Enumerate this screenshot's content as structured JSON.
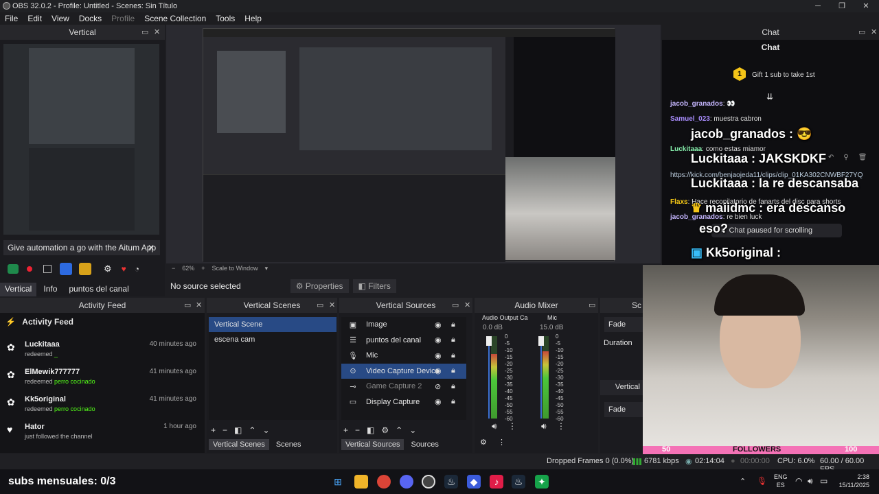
{
  "window": {
    "title": "OBS 32.0.2 - Profile: Untitled - Scenes: Sin Título"
  },
  "menu": [
    "File",
    "Edit",
    "View",
    "Docks",
    "Profile",
    "Scene Collection",
    "Tools",
    "Help"
  ],
  "vertical_dock": {
    "title": "Vertical",
    "banner": "Give automation a go with the Aitum App",
    "tabs": [
      "Vertical",
      "Info",
      "puntos del canal"
    ]
  },
  "canvas": {
    "zoom": "62%",
    "scale_mode": "Scale to Window",
    "no_source": "No source selected",
    "properties_label": "Properties",
    "filters_label": "Filters"
  },
  "activity_feed": {
    "dock_title": "Activity Feed",
    "header": "Activity Feed",
    "items": [
      {
        "name": "Luckitaaa",
        "action": "redeemed",
        "reward": "_",
        "time": "40 minutes ago"
      },
      {
        "name": "ElMewik777777",
        "action": "redeemed",
        "reward": "perro cocinado",
        "time": "41 minutes ago"
      },
      {
        "name": "Kk5original",
        "action": "redeemed",
        "reward": "perro cocinado",
        "time": "41 minutes ago"
      },
      {
        "name": "Hator",
        "action": "just followed the channel",
        "reward": "",
        "time": "1 hour ago"
      }
    ]
  },
  "vertical_scenes": {
    "dock_title": "Vertical Scenes",
    "items": [
      "Vertical Scene",
      "escena cam"
    ],
    "selected": "Vertical Scene",
    "tabs": [
      "Vertical Scenes",
      "Scenes"
    ]
  },
  "vertical_sources": {
    "dock_title": "Vertical Sources",
    "items": [
      {
        "name": "Image",
        "icon": "image-icon"
      },
      {
        "name": "puntos del canal",
        "icon": "list-icon"
      },
      {
        "name": "Mic",
        "icon": "mic-icon"
      },
      {
        "name": "Video Capture Device",
        "icon": "camera-icon"
      },
      {
        "name": "Game Capture 2",
        "icon": "gamepad-icon"
      },
      {
        "name": "Display Capture",
        "icon": "monitor-icon"
      }
    ],
    "selected": "Video Capture Device",
    "tabs": [
      "Vertical Sources",
      "Sources"
    ]
  },
  "audio_mixer": {
    "dock_title": "Audio Mixer",
    "channels": [
      {
        "name": "Audio Output Ca",
        "db": "0.0 dB",
        "level": 0.78
      },
      {
        "name": "Mic",
        "db": "15.0 dB",
        "level": 0.82
      }
    ],
    "scale": [
      "0",
      "-5",
      "-10",
      "-15",
      "-20",
      "-25",
      "-30",
      "-35",
      "-40",
      "-45",
      "-50",
      "-55",
      "-60"
    ]
  },
  "transitions": {
    "fade1": "Fade",
    "duration_label": "Duration",
    "vertical_label": "Vertical",
    "fade2": "Fade"
  },
  "chat": {
    "dock_title": "Chat",
    "header": "Chat",
    "gift_text": "Gift 1 sub to take 1st",
    "gift_count": "1",
    "small_lines": [
      {
        "user": "jacob_granados",
        "msg": ": 👀"
      },
      {
        "user": "Samuel_023",
        "msg": ": muestra cabron"
      },
      {
        "user": "Luckitaaa",
        "msg": ": como estas miamor"
      },
      {
        "user": "Flaxs",
        "msg": ": Hace recopilatorio de fanarts del disc para shorts"
      },
      {
        "user": "jacob_granados",
        "msg": ": re bien luck"
      }
    ],
    "link": "https://kick.com/benjaojeda11/clips/clip_01KA302CNWBF27YQ",
    "big_lines": [
      {
        "user": "jacob_granados",
        "msg": " : 😎"
      },
      {
        "user": "Luckitaaa",
        "msg": " : JAKSKDKF"
      },
      {
        "user": "Luckitaaa",
        "msg": " : la re descansaba"
      },
      {
        "user": "maiidmc",
        "msg": " : era descanso"
      },
      {
        "user": "",
        "msg": "eso?"
      },
      {
        "user": "Kk5original",
        "msg": " :"
      }
    ],
    "paused": "Chat paused for scrolling"
  },
  "overlay": {
    "subs": "subs mensuales: 0/3",
    "followers_current": "50",
    "followers_label": "FOLLOWERS",
    "followers_goal": "100"
  },
  "statusbar": {
    "dropped": "Dropped Frames 0 (0.0%)",
    "bitrate": "6781 kbps",
    "stream_time": "02:14:04",
    "rec_time": "00:00:00",
    "cpu": "CPU: 6.0%",
    "fps": "60.00 / 60.00 FPS"
  },
  "taskbar": {
    "lang": "ENG",
    "region": "ES",
    "time": "2:38",
    "date": "15/11/2025"
  },
  "colors": {
    "accent": "#284a85",
    "kick_green": "#53fc18",
    "followers_pink": "#f472b6"
  }
}
